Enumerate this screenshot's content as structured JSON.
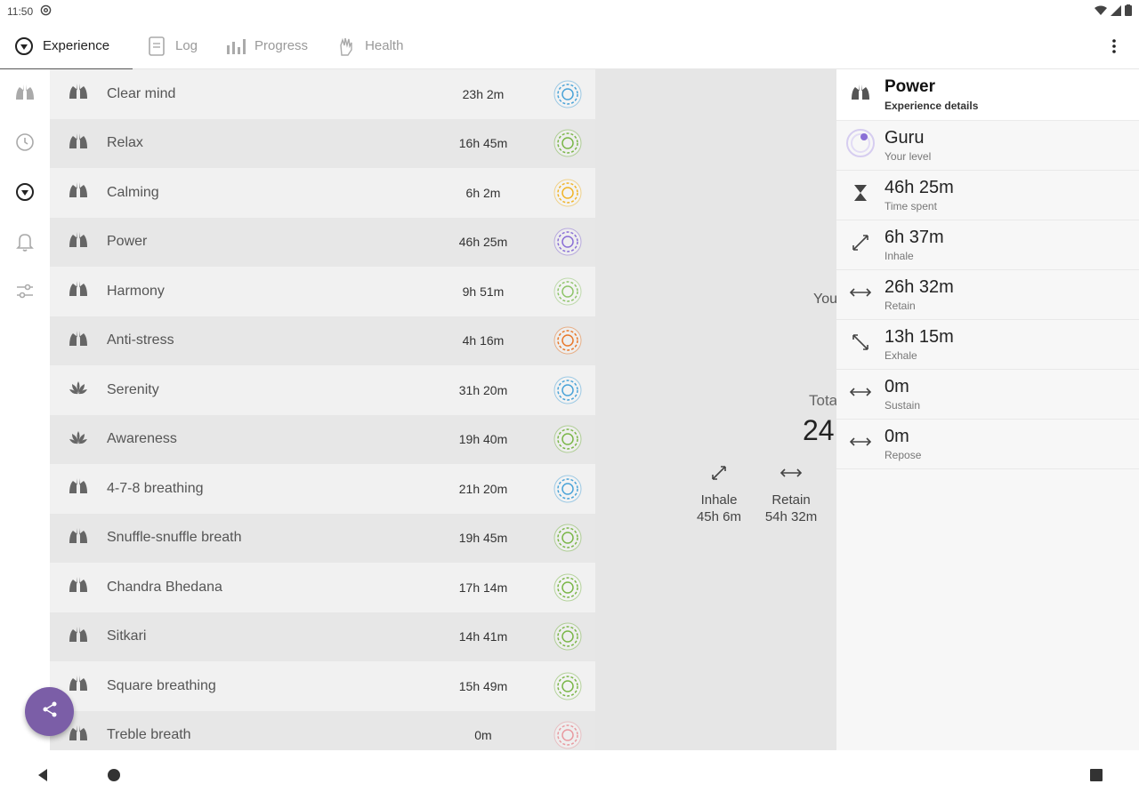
{
  "status": {
    "time": "11:50",
    "left_icon": "at-sign-icon",
    "right_icons": [
      "wifi-icon",
      "signal-icon",
      "battery-icon"
    ]
  },
  "tabs": [
    {
      "label": "Experience",
      "icon": "compass-icon",
      "active": true
    },
    {
      "label": "Log",
      "icon": "document-icon",
      "active": false
    },
    {
      "label": "Progress",
      "icon": "bar-chart-icon",
      "active": false
    },
    {
      "label": "Health",
      "icon": "hand-icon",
      "active": false
    }
  ],
  "rail": [
    "lungs-icon",
    "clock-icon",
    "compass-icon",
    "bell-icon",
    "sliders-icon"
  ],
  "exercises": [
    {
      "name": "Clear mind",
      "time": "23h 2m",
      "icon": "lungs-icon",
      "badge_color": "#4aa3d8"
    },
    {
      "name": "Relax",
      "time": "16h 45m",
      "icon": "lungs-icon",
      "badge_color": "#7ab648"
    },
    {
      "name": "Calming",
      "time": "6h 2m",
      "icon": "lungs-icon",
      "badge_color": "#f0b428"
    },
    {
      "name": "Power",
      "time": "46h 25m",
      "icon": "lungs-icon",
      "badge_color": "#8a6fd6"
    },
    {
      "name": "Harmony",
      "time": "9h 51m",
      "icon": "lungs-icon",
      "badge_color": "#8ec46a"
    },
    {
      "name": "Anti-stress",
      "time": "4h 16m",
      "icon": "lungs-icon",
      "badge_color": "#e8782a"
    },
    {
      "name": "Serenity",
      "time": "31h 20m",
      "icon": "lotus-icon",
      "badge_color": "#4aa3d8"
    },
    {
      "name": "Awareness",
      "time": "19h 40m",
      "icon": "lotus-icon",
      "badge_color": "#7ab648"
    },
    {
      "name": "4-7-8 breathing",
      "time": "21h 20m",
      "icon": "lungs-icon",
      "badge_color": "#4aa3d8"
    },
    {
      "name": "Snuffle-snuffle breath",
      "time": "19h 45m",
      "icon": "lungs-icon",
      "badge_color": "#7ab648"
    },
    {
      "name": "Chandra Bhedana",
      "time": "17h 14m",
      "icon": "lungs-icon",
      "badge_color": "#7ab648"
    },
    {
      "name": "Sitkari",
      "time": "14h 41m",
      "icon": "lungs-icon",
      "badge_color": "#7ab648"
    },
    {
      "name": "Square breathing",
      "time": "15h 49m",
      "icon": "lungs-icon",
      "badge_color": "#7ab648"
    },
    {
      "name": "Treble breath",
      "time": "0m",
      "icon": "lungs-icon",
      "badge_color": "#e89aa0"
    }
  ],
  "middle": {
    "your_label": "You",
    "total_label": "Tota",
    "total_value": "24",
    "stats": [
      {
        "label": "Inhale",
        "value": "45h 6m",
        "icon": "diagonal-up-icon"
      },
      {
        "label": "Retain",
        "value": "54h 32m",
        "icon": "horizontal-arrow-icon"
      }
    ]
  },
  "details": {
    "title": "Power",
    "subtitle": "Experience details",
    "rows": [
      {
        "value": "Guru",
        "label": "Your level",
        "icon": "level-badge-icon"
      },
      {
        "value": "46h 25m",
        "label": "Time spent",
        "icon": "hourglass-icon"
      },
      {
        "value": "6h 37m",
        "label": "Inhale",
        "icon": "diagonal-up-icon"
      },
      {
        "value": "26h 32m",
        "label": "Retain",
        "icon": "horizontal-arrow-icon"
      },
      {
        "value": "13h 15m",
        "label": "Exhale",
        "icon": "diagonal-down-icon"
      },
      {
        "value": "0m",
        "label": "Sustain",
        "icon": "horizontal-arrow-icon"
      },
      {
        "value": "0m",
        "label": "Repose",
        "icon": "horizontal-arrow-icon"
      }
    ]
  },
  "colors": {
    "fab": "#7b5ea7",
    "accent_level": "#8a6fd6"
  }
}
